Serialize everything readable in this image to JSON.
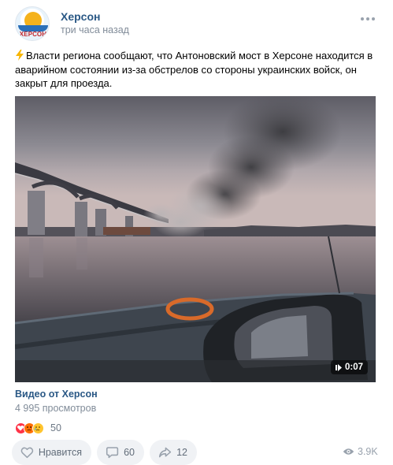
{
  "group": {
    "name": "Херсон",
    "time": "три часа назад",
    "avatar_text": "ХЕРСОН"
  },
  "post": {
    "text": "Власти региона сообщают, что Антоновский мост в Херсоне находится в аварийном состоянии из-за обстрелов со стороны украинских войск, он закрыт для проезда."
  },
  "video": {
    "duration": "0:07",
    "title": "Видео от Херсон",
    "views": "4 995 просмотров"
  },
  "reactions": {
    "icons": [
      "heart-reaction",
      "angry-reaction",
      "crying-reaction"
    ],
    "count": "50"
  },
  "actions": {
    "like_label": "Нравится",
    "comments": "60",
    "shares": "12",
    "views": "3.9K"
  },
  "colors": {
    "link": "#2a5885",
    "secondary": "#818c99",
    "button_bg": "#f0f2f5",
    "icon": "#99a2ad"
  }
}
